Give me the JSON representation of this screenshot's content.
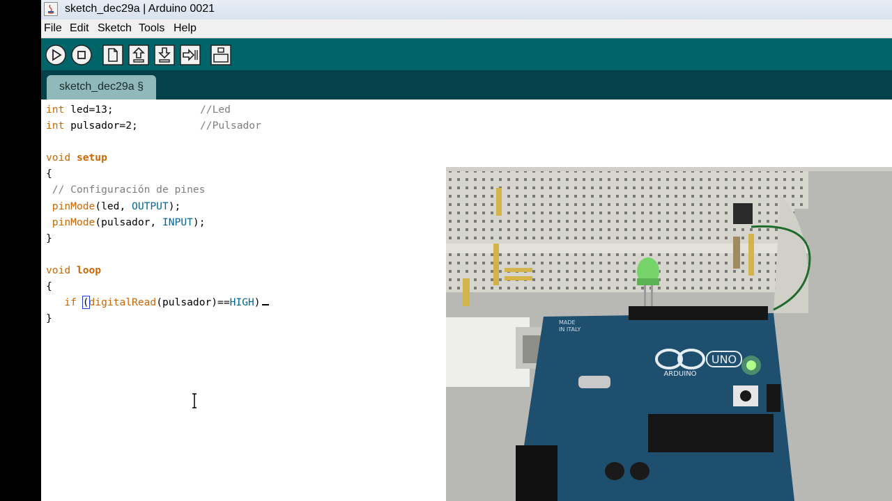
{
  "window": {
    "title": "sketch_dec29a | Arduino 0021"
  },
  "menu": [
    "File",
    "Edit",
    "Sketch",
    "Tools",
    "Help"
  ],
  "tab": {
    "label": "sketch_dec29a §"
  },
  "code": {
    "l1_kw": "int",
    "l1_rest": " led=13;",
    "l1_cm": "//Led",
    "l2_kw": "int",
    "l2_rest": " pulsador=2;",
    "l2_cm": "//Pulsador",
    "l4_kw": "void",
    "l4_fn": "setup",
    "l5": "{",
    "l6_cm": "// Configuración de pines",
    "l7_fn": "pinMode",
    "l7_a": "(led, ",
    "l7_c": "OUTPUT",
    "l7_b": ");",
    "l8_fn": "pinMode",
    "l8_a": "(pulsador, ",
    "l8_c": "INPUT",
    "l8_b": ");",
    "l9": "}",
    "l11_kw": "void",
    "l11_fn": "loop",
    "l12": "{",
    "l13_kw": "if",
    "l13_paren": "(",
    "l13_fn": "digitalRead",
    "l13_a": "(pulsador)==",
    "l13_c": "HIGH",
    "l13_b": ")",
    "l14": "}"
  },
  "photo": {
    "board_brand": "ARDUINO",
    "board_model": "UNO",
    "board_label_made": "MADE",
    "board_label_italy": "IN ITALY"
  },
  "colors": {
    "toolbar": "#006468",
    "tabbar": "#04414a",
    "tab": "#8fb9bb",
    "keyword": "#cc6600",
    "constant": "#006699",
    "comment": "#7e7e7e"
  }
}
